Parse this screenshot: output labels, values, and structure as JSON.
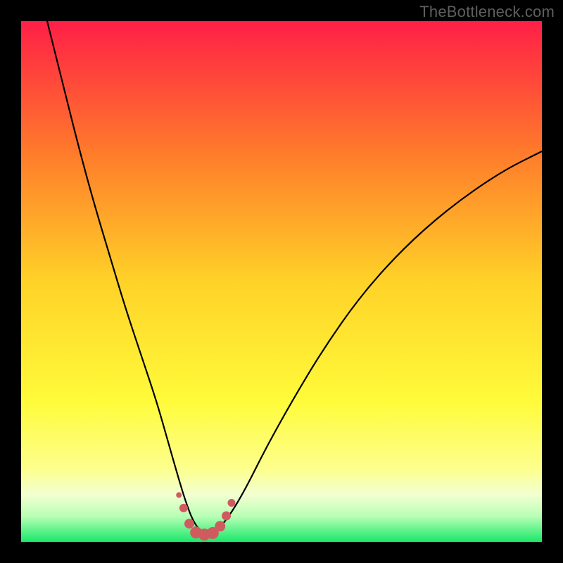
{
  "watermark": "TheBottleneck.com",
  "colors": {
    "frame_bg": "#000000",
    "gradient_top": "#ff1f47",
    "gradient_25": "#ff7a2b",
    "gradient_50": "#ffd228",
    "gradient_73": "#fffb3a",
    "gradient_86": "#fdff8e",
    "gradient_91": "#f2ffd2",
    "gradient_95": "#baffb6",
    "gradient_100": "#19e86b",
    "curve": "#000000",
    "marker_fill": "#cf5b5e",
    "marker_stroke": "#cf5b5e"
  },
  "chart_data": {
    "type": "line",
    "title": "",
    "xlabel": "",
    "ylabel": "",
    "xlim": [
      0,
      100
    ],
    "ylim": [
      0,
      100
    ],
    "grid": false,
    "series": [
      {
        "name": "bottleneck-curve",
        "x": [
          5,
          8,
          11,
          14,
          17,
          20,
          23,
          26,
          28,
          30,
          31.5,
          33,
          34.5,
          36,
          37.5,
          40,
          43,
          47,
          52,
          58,
          65,
          73,
          82,
          92,
          100
        ],
        "y": [
          100,
          88,
          76,
          65,
          55,
          45,
          36,
          27,
          20,
          13,
          8,
          4,
          2,
          1.5,
          2,
          5,
          10,
          18,
          27,
          37,
          47,
          56,
          64,
          71,
          75
        ]
      }
    ],
    "markers": {
      "name": "highlighted-minimum",
      "points": [
        {
          "x": 30.3,
          "y": 9.0,
          "r": 4
        },
        {
          "x": 31.2,
          "y": 6.5,
          "r": 6
        },
        {
          "x": 32.3,
          "y": 3.5,
          "r": 7
        },
        {
          "x": 33.6,
          "y": 1.8,
          "r": 8.5
        },
        {
          "x": 35.2,
          "y": 1.4,
          "r": 8.5
        },
        {
          "x": 36.8,
          "y": 1.7,
          "r": 8.5
        },
        {
          "x": 38.2,
          "y": 3.0,
          "r": 7.5
        },
        {
          "x": 39.4,
          "y": 5.0,
          "r": 6.5
        },
        {
          "x": 40.4,
          "y": 7.5,
          "r": 5.5
        }
      ]
    }
  }
}
